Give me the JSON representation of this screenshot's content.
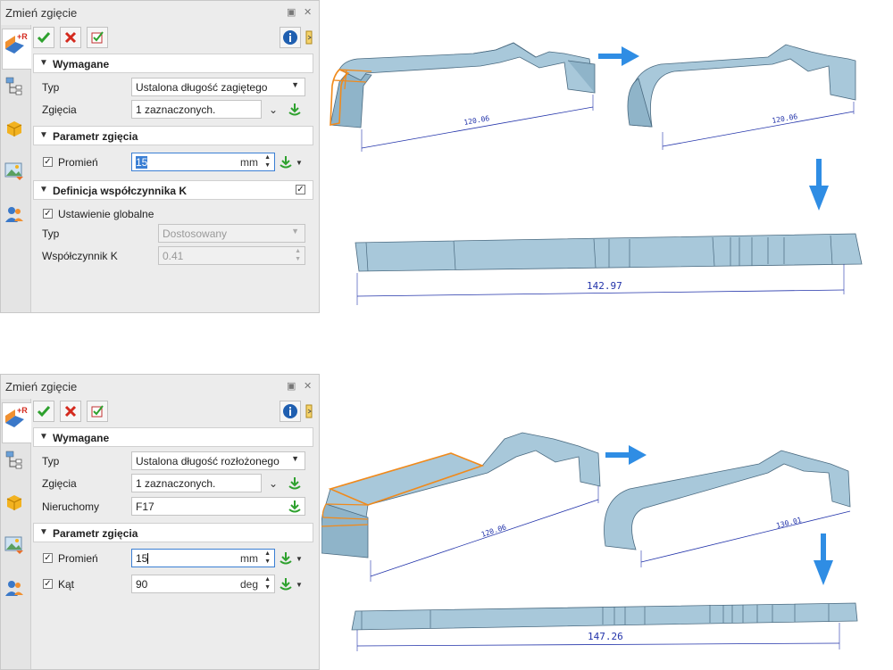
{
  "panel1": {
    "title": "Zmień zgięcie",
    "sections": {
      "required": "Wymagane",
      "bend_param": "Parametr zgięcia",
      "kfactor": "Definicja współczynnika K"
    },
    "type_label": "Typ",
    "type_value": "Ustalona długość zagiętego",
    "bends_label": "Zgięcia",
    "bends_value": "1 zaznaczonych.",
    "radius_label": "Promień",
    "radius_value": "15",
    "radius_unit": "mm",
    "global_label": "Ustawienie globalne",
    "ktype_label": "Typ",
    "ktype_value": "Dostosowany",
    "kcoef_label": "Współczynnik K",
    "kcoef_value": "0.41"
  },
  "panel2": {
    "title": "Zmień zgięcie",
    "sections": {
      "required": "Wymagane",
      "bend_param": "Parametr zgięcia"
    },
    "type_label": "Typ",
    "type_value": "Ustalona długość rozłożonego",
    "bends_label": "Zgięcia",
    "bends_value": "1 zaznaczonych.",
    "fixed_label": "Nieruchomy",
    "fixed_value": "F17",
    "radius_label": "Promień",
    "radius_value": "15",
    "radius_unit": "mm",
    "angle_label": "Kąt",
    "angle_value": "90",
    "angle_unit": "deg"
  },
  "tab_badge": "+R",
  "dimensions": {
    "top_bent_before": "120.06",
    "top_bent_after": "120.06",
    "top_flat": "142.97",
    "bottom_bent_before": "120.06",
    "bottom_bent_after": "130.01",
    "bottom_flat": "147.26"
  },
  "icons": {
    "ok": "check-icon",
    "cancel": "x-icon",
    "apply": "apply-check-icon",
    "info": "info-icon",
    "pin": "pin-icon",
    "pick": "pick-geometry-icon"
  },
  "colors": {
    "ok_green": "#2ea12e",
    "cancel_red": "#d42a1e",
    "arrow_blue": "#2f8de4",
    "part_blue": "#9cc3d8",
    "highlight_orange": "#f08a1c",
    "dimension_blue": "#2233aa"
  }
}
